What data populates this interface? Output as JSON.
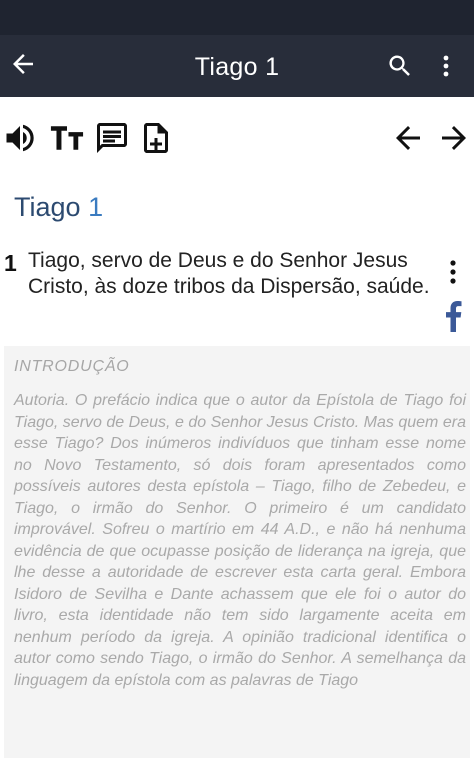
{
  "appbar": {
    "title": "Tiago 1",
    "icons": [
      "arrow-back-icon",
      "search-icon",
      "more-vert-icon"
    ]
  },
  "toolbar": {
    "icons": [
      "volume-icon",
      "text-size-icon",
      "comment-icon",
      "note-add-icon",
      "prev-chapter-arrow-icon",
      "next-chapter-arrow-icon"
    ]
  },
  "chapter": {
    "book": "Tiago",
    "number": "1"
  },
  "verse": {
    "number": "1",
    "text": "Tiago, servo de Deus e do Senhor Jesus Cristo, às doze tribos da Dispersão, saúde."
  },
  "intro": {
    "heading": "INTRODUÇÃO",
    "body": "Autoria. O prefácio indica que o autor da Epístola de Tiago foi Tiago, servo de Deus, e do Senhor Jesus Cristo. Mas quem era esse Tiago? Dos inúmeros indivíduos que tinham esse nome no Novo Testamento, só dois foram apresentados como possíveis autores desta epístola – Tiago, filho de Zebedeu, e Tiago, o irmão do Senhor. O primeiro é um candidato improvável. Sofreu o martírio em 44 A.D., e não há nenhuma evidência de que ocupasse posição de liderança na igreja, que lhe desse a autoridade de escrever esta carta geral. Embora Isidoro de Sevilha e Dante achassem que ele foi o autor do livro, esta identidade não tem sido largamente aceita em nenhum período da igreja. A opinião tradicional identifica o autor como sendo Tiago, o irmão do Senhor. A semelhança da linguagem da epístola com as palavras de Tiago"
  },
  "colors": {
    "appbar": "#282d3a",
    "statusbar": "#1f2430",
    "chapter_title": "#2c4a70",
    "chapter_number": "#3a7bc0",
    "facebook": "#3b5998"
  }
}
